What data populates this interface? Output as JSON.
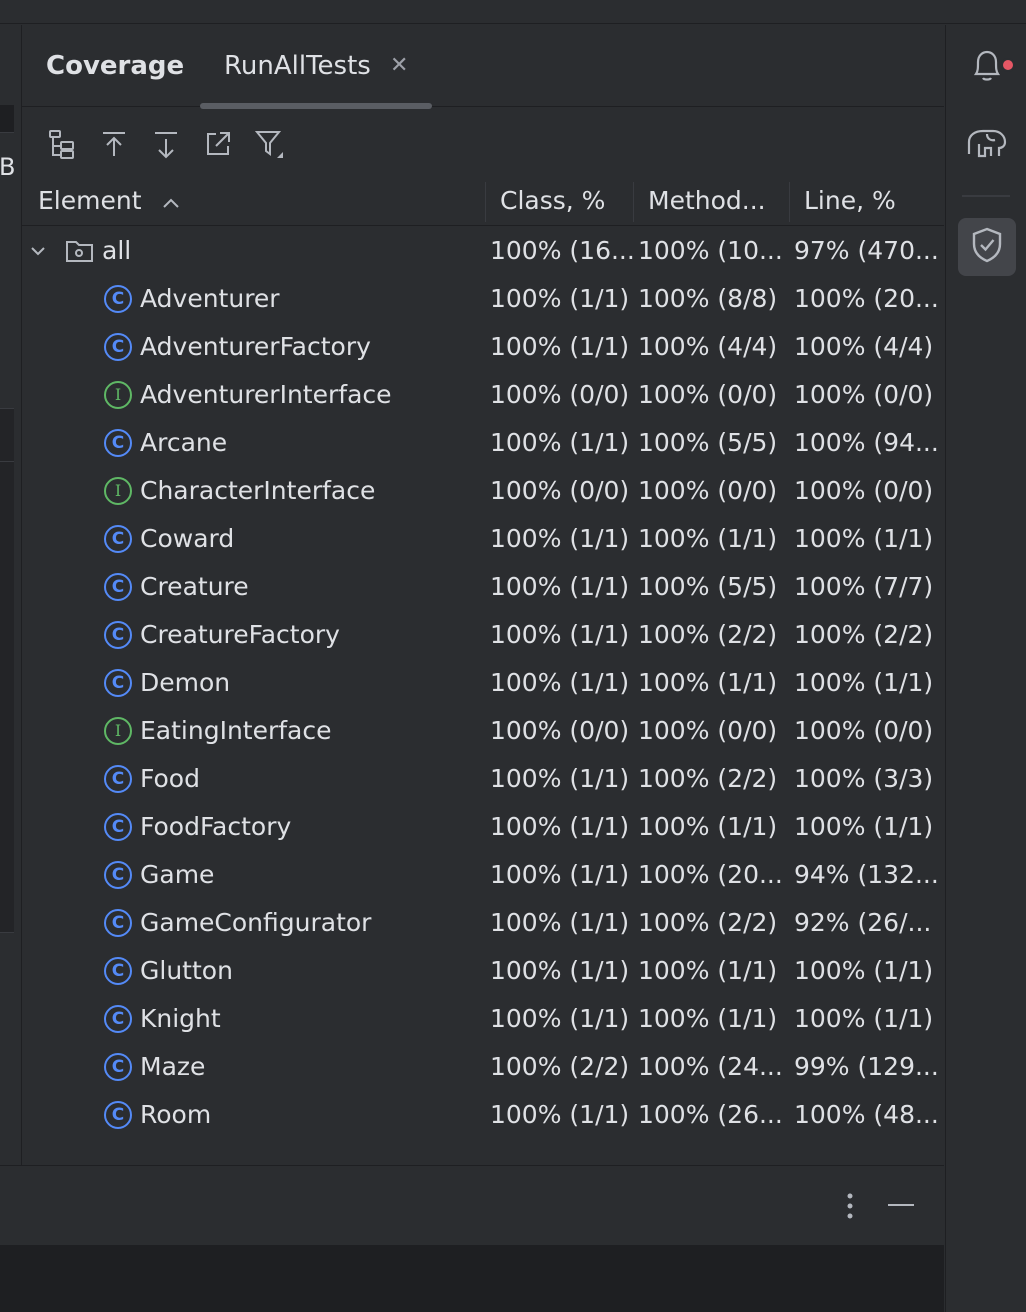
{
  "panel": {
    "title": "Coverage",
    "tab_label": "RunAllTests"
  },
  "toolbar": {
    "icons": [
      "flatten-packages-icon",
      "navigate-up-icon",
      "navigate-down-icon",
      "open-external-icon",
      "filter-icon"
    ]
  },
  "table": {
    "columns": [
      "Element",
      "Class, %",
      "Method...",
      "Line, %"
    ],
    "sort_indicator": "ascending",
    "root": {
      "name": "all",
      "class_pct": "100% (16...",
      "method_pct": "100% (10...",
      "line_pct": "97% (470..."
    },
    "rows": [
      {
        "name": "Adventurer",
        "kind": "class",
        "class_pct": "100% (1/1)",
        "method_pct": "100% (8/8)",
        "line_pct": "100% (20..."
      },
      {
        "name": "AdventurerFactory",
        "kind": "class",
        "class_pct": "100% (1/1)",
        "method_pct": "100% (4/4)",
        "line_pct": "100% (4/4)"
      },
      {
        "name": "AdventurerInterface",
        "kind": "interface",
        "class_pct": "100% (0/0)",
        "method_pct": "100% (0/0)",
        "line_pct": "100% (0/0)"
      },
      {
        "name": "Arcane",
        "kind": "class",
        "class_pct": "100% (1/1)",
        "method_pct": "100% (5/5)",
        "line_pct": "100% (94..."
      },
      {
        "name": "CharacterInterface",
        "kind": "interface",
        "class_pct": "100% (0/0)",
        "method_pct": "100% (0/0)",
        "line_pct": "100% (0/0)"
      },
      {
        "name": "Coward",
        "kind": "class",
        "class_pct": "100% (1/1)",
        "method_pct": "100% (1/1)",
        "line_pct": "100% (1/1)"
      },
      {
        "name": "Creature",
        "kind": "class",
        "class_pct": "100% (1/1)",
        "method_pct": "100% (5/5)",
        "line_pct": "100% (7/7)"
      },
      {
        "name": "CreatureFactory",
        "kind": "class",
        "class_pct": "100% (1/1)",
        "method_pct": "100% (2/2)",
        "line_pct": "100% (2/2)"
      },
      {
        "name": "Demon",
        "kind": "class",
        "class_pct": "100% (1/1)",
        "method_pct": "100% (1/1)",
        "line_pct": "100% (1/1)"
      },
      {
        "name": "EatingInterface",
        "kind": "interface",
        "class_pct": "100% (0/0)",
        "method_pct": "100% (0/0)",
        "line_pct": "100% (0/0)"
      },
      {
        "name": "Food",
        "kind": "class",
        "class_pct": "100% (1/1)",
        "method_pct": "100% (2/2)",
        "line_pct": "100% (3/3)"
      },
      {
        "name": "FoodFactory",
        "kind": "class",
        "class_pct": "100% (1/1)",
        "method_pct": "100% (1/1)",
        "line_pct": "100% (1/1)"
      },
      {
        "name": "Game",
        "kind": "class",
        "class_pct": "100% (1/1)",
        "method_pct": "100% (20...",
        "line_pct": "94% (132..."
      },
      {
        "name": "GameConfigurator",
        "kind": "class",
        "class_pct": "100% (1/1)",
        "method_pct": "100% (2/2)",
        "line_pct": "92% (26/..."
      },
      {
        "name": "Glutton",
        "kind": "class",
        "class_pct": "100% (1/1)",
        "method_pct": "100% (1/1)",
        "line_pct": "100% (1/1)"
      },
      {
        "name": "Knight",
        "kind": "class",
        "class_pct": "100% (1/1)",
        "method_pct": "100% (1/1)",
        "line_pct": "100% (1/1)"
      },
      {
        "name": "Maze",
        "kind": "class",
        "class_pct": "100% (2/2)",
        "method_pct": "100% (24...",
        "line_pct": "99% (129..."
      },
      {
        "name": "Room",
        "kind": "class",
        "class_pct": "100% (1/1)",
        "method_pct": "100% (26...",
        "line_pct": "100% (48..."
      }
    ]
  },
  "icon_glyphs": {
    "class": "C",
    "interface": "I"
  },
  "left_edge": {
    "partial_letter": "B"
  },
  "colors": {
    "background": "#2b2d30",
    "text": "#dfe1e5",
    "class_icon": "#548af7",
    "interface_icon": "#5fb865",
    "notification_badge": "#e55765"
  }
}
